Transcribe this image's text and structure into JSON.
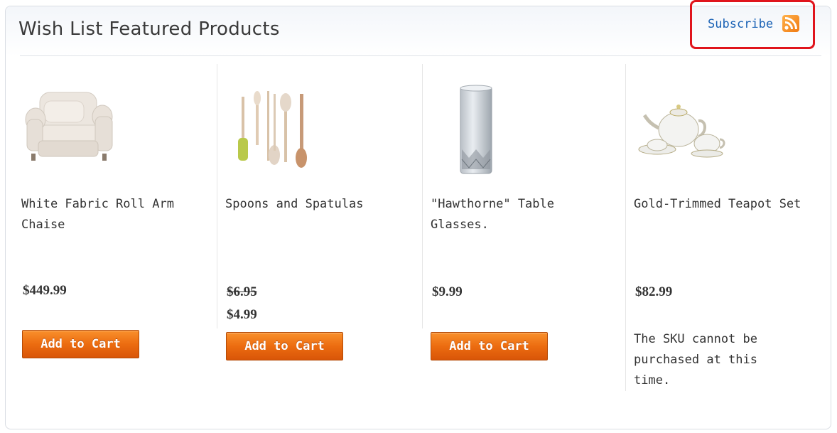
{
  "widget": {
    "title": "Wish List Featured Products",
    "subscribe_label": "Subscribe"
  },
  "products": [
    {
      "name": "White Fabric Roll Arm Chaise",
      "price": "$449.99",
      "button": "Add to Cart",
      "image": "armchair"
    },
    {
      "name": "Spoons and Spatulas",
      "old_price": "$6.95",
      "price": "$4.99",
      "button": "Add to Cart",
      "image": "spoons-spatulas"
    },
    {
      "name": "\"Hawthorne\" Table Glasses.",
      "price": "$9.99",
      "button": "Add to Cart",
      "image": "glass"
    },
    {
      "name": "Gold-Trimmed Teapot Set",
      "price": "$82.99",
      "unavailable_message": "The SKU cannot be purchased at this time.",
      "image": "teapot-set"
    }
  ],
  "colors": {
    "accent_button": "#ec6c10",
    "highlight_border": "#e0141c",
    "link": "#1a62b5",
    "rss": "#f07a12"
  },
  "icons": [
    "rss-icon"
  ]
}
